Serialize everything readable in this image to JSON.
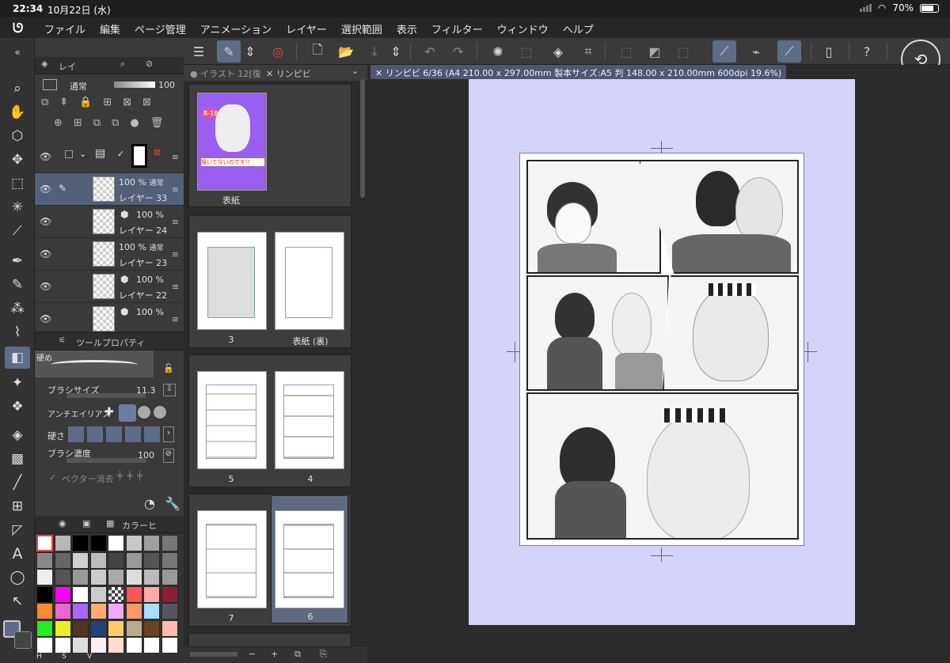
{
  "status": {
    "time": "22:34",
    "date": "10月22日 (水)",
    "battery": "70%"
  },
  "menu": [
    "ファイル",
    "編集",
    "ページ管理",
    "アニメーション",
    "レイヤー",
    "選択範囲",
    "表示",
    "フィルター",
    "ウィンドウ",
    "ヘルプ"
  ],
  "layers": {
    "tab_label": "レイ",
    "blend_mode": "通常",
    "opacity": "100",
    "items": [
      {
        "pct": "100 %",
        "mode": "通常",
        "name": "レイヤー 33",
        "selected": true
      },
      {
        "pct": "100 %",
        "mode": "",
        "name": "レイヤー 24",
        "selected": false
      },
      {
        "pct": "100 %",
        "mode": "通常",
        "name": "レイヤー 23",
        "selected": false
      },
      {
        "pct": "100 %",
        "mode": "",
        "name": "レイヤー 22",
        "selected": false
      },
      {
        "pct": "100 %",
        "mode": "",
        "name": "",
        "selected": false
      }
    ]
  },
  "tool_property": {
    "title": "ツールプロパティ",
    "preset": "硬め",
    "brush_size_label": "ブラシサイズ",
    "brush_size": "11.3",
    "antialias_label": "アンチエイリアス",
    "hardness_label": "硬さ",
    "density_label": "ブラシ濃度",
    "density": "100",
    "vector_erase_label": "ベクター消去"
  },
  "color_panel": {
    "tab_label": "カラーヒ",
    "hsv": [
      "H",
      "S",
      "V"
    ],
    "swatches": [
      "#ffffff",
      "#b8b8b8",
      "#000000",
      "#000000",
      "#ffffff",
      "#c8c8c8",
      "#a0a0a0",
      "#777777",
      "#888888",
      "#666666",
      "#d0d0d0",
      "#bbbbbb",
      "#444444",
      "#999999",
      "#555555",
      "#777777",
      "#eeeeee",
      "#555555",
      "#999999",
      "#cccccc",
      "#aaaaaa",
      "#dddddd",
      "#bbbbbb",
      "#999999",
      "#000000",
      "#ff00ff",
      "#ffffff",
      "#cccccc",
      "#checker",
      "#ff5555",
      "#ffaaaa",
      "#882233",
      "#ff8833",
      "#ee66cc",
      "#aa66ff",
      "#ffaa77",
      "#eeaaff",
      "#ff9966",
      "#aaddff",
      "#555566",
      "#22ee22",
      "#eeee22",
      "#553322",
      "#224477",
      "#ffcc66",
      "#bbaa88",
      "#664422",
      "#ffbbaa",
      "#ffffff",
      "#ffffff",
      "#dddddd",
      "#ffeeee",
      "#ffddcc",
      "#ffffff",
      "#ffffff",
      "#ffffff"
    ]
  },
  "pages": {
    "tabs": [
      "イラスト 12[復",
      "リンピビ"
    ],
    "cards": [
      {
        "label": "表紙"
      },
      {
        "label": "3"
      },
      {
        "label": "表紙 (裏)"
      },
      {
        "label": "5"
      },
      {
        "label": "4"
      },
      {
        "label": "7"
      },
      {
        "label": "6"
      }
    ],
    "cover_badge": "R-18",
    "cover_title": "描いてないのです!!"
  },
  "canvas": {
    "tab": "リンピビ 6/36 (A4 210.00 x 297.00mm 製本サイズ:A5 判 148.00 x 210.00mm 600dpi 19.6%)",
    "paper_color": "#d4d4fb",
    "accent": "#5c6d8a"
  },
  "icons": [
    "search-icon",
    "hand-icon",
    "move-icon",
    "select-icon",
    "wand-icon",
    "eyedropper-icon",
    "pen-icon",
    "eraser-icon",
    "fill-icon",
    "gradient-icon",
    "line-icon",
    "text-icon",
    "lasso-icon",
    "rotate-icon"
  ]
}
